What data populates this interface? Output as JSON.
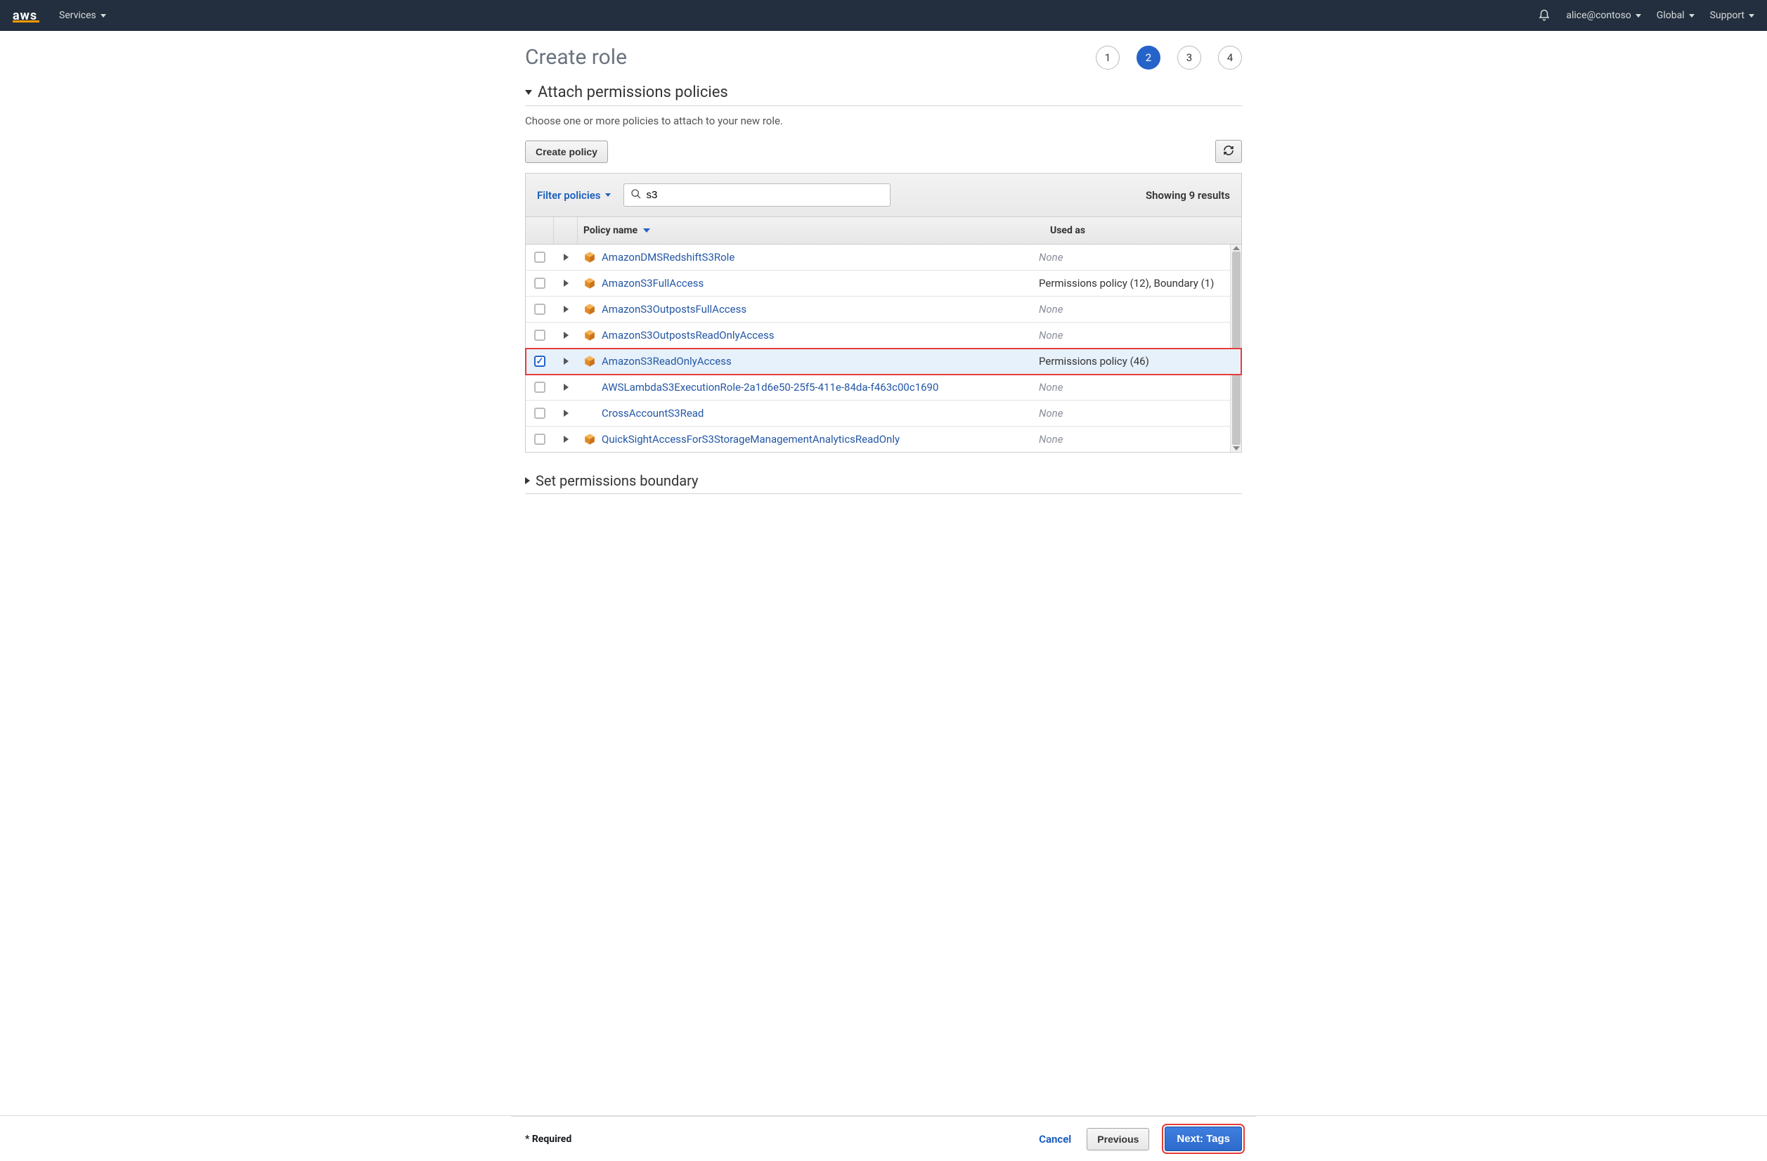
{
  "topnav": {
    "logo_text": "aws",
    "services": "Services",
    "user": "alice@contoso",
    "region": "Global",
    "support": "Support"
  },
  "page": {
    "title": "Create role",
    "steps": [
      "1",
      "2",
      "3",
      "4"
    ],
    "active_step_index": 1
  },
  "attach_section": {
    "heading": "Attach permissions policies",
    "helptext": "Choose one or more policies to attach to your new role.",
    "create_policy_btn": "Create policy",
    "filter_label": "Filter policies",
    "search_value": "s3",
    "results_text": "Showing 9 results",
    "columns": {
      "name": "Policy name",
      "used": "Used as"
    },
    "rows": [
      {
        "name": "AmazonDMSRedshiftS3Role",
        "used": "None",
        "none": true,
        "managed": true,
        "checked": false
      },
      {
        "name": "AmazonS3FullAccess",
        "used": "Permissions policy (12), Boundary (1)",
        "none": false,
        "managed": true,
        "checked": false
      },
      {
        "name": "AmazonS3OutpostsFullAccess",
        "used": "None",
        "none": true,
        "managed": true,
        "checked": false
      },
      {
        "name": "AmazonS3OutpostsReadOnlyAccess",
        "used": "None",
        "none": true,
        "managed": true,
        "checked": false
      },
      {
        "name": "AmazonS3ReadOnlyAccess",
        "used": "Permissions policy (46)",
        "none": false,
        "managed": true,
        "checked": true,
        "highlighted": true
      },
      {
        "name": "AWSLambdaS3ExecutionRole-2a1d6e50-25f5-411e-84da-f463c00c1690",
        "used": "None",
        "none": true,
        "managed": false,
        "checked": false
      },
      {
        "name": "CrossAccountS3Read",
        "used": "None",
        "none": true,
        "managed": false,
        "checked": false
      },
      {
        "name": "QuickSightAccessForS3StorageManagementAnalyticsReadOnly",
        "used": "None",
        "none": true,
        "managed": true,
        "checked": false
      }
    ]
  },
  "boundary_section": {
    "heading": "Set permissions boundary"
  },
  "footer": {
    "required": "* Required",
    "cancel": "Cancel",
    "previous": "Previous",
    "next": "Next: Tags"
  }
}
